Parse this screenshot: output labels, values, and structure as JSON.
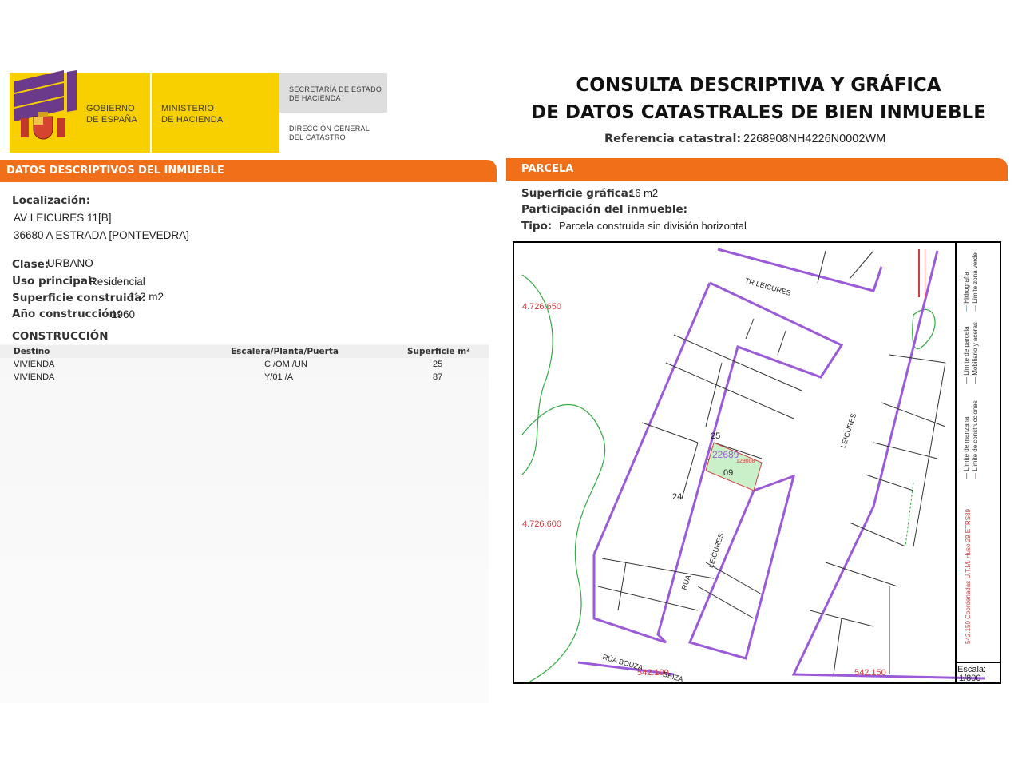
{
  "logo": {
    "gov_line1": "GOBIERNO",
    "gov_line2": "DE ESPAÑA",
    "min_line1": "MINISTERIO",
    "min_line2": "DE HACIENDA",
    "sec_line1": "SECRETARÍA DE ESTADO",
    "sec_line2": "DE HACIENDA",
    "dir_line1": "DIRECCIÓN GENERAL",
    "dir_line2": "DEL CATASTRO"
  },
  "header": {
    "title_line1": "CONSULTA DESCRIPTIVA Y GRÁFICA",
    "title_line2": "DE DATOS CATASTRALES DE BIEN INMUEBLE",
    "ref_label": "Referencia catastral:",
    "ref_value": "2268908NH4226N0002WM"
  },
  "left": {
    "section_title": "DATOS DESCRIPTIVOS DEL INMUEBLE",
    "loc_label": "Localización:",
    "loc_line1": "AV LEICURES 11[B]",
    "loc_line2": "36680 A ESTRADA [PONTEVEDRA]",
    "clase_label": "Clase:",
    "clase_value": "URBANO",
    "uso_label": "Uso principal:",
    "uso_value": "Residencial",
    "sup_label": "Superficie construida:",
    "sup_value": "112 m2",
    "ano_label": "Año construcción:",
    "ano_value": "1960",
    "construccion_title": "CONSTRUCCIÓN",
    "table": {
      "headers": [
        "Destino",
        "Escalera/Planta/Puerta",
        "Superficie m²"
      ],
      "rows": [
        [
          "VIVIENDA",
          "C /OM /UN",
          "25"
        ],
        [
          "VIVIENDA",
          "Y/01 /A",
          "87"
        ]
      ]
    }
  },
  "right": {
    "section_title": "PARCELA",
    "supg_label": "Superficie gráfica:",
    "supg_value": "16 m2",
    "part_label": "Participación del inmueble:",
    "tipo_label": "Tipo:",
    "tipo_value": "Parcela construida sin división horizontal"
  },
  "map": {
    "coord_y1": "4.726.650",
    "coord_y2": "4.726.600",
    "coord_x1": "542.100",
    "coord_x2": "542.150",
    "street_top": "TR LEICURES",
    "street_main": "LEICURES",
    "street_rua1": "RÚA",
    "street_rua2": "LEICURES",
    "street_bottom": "RÚA BOUZA",
    "street_bottom2": "BEIZA",
    "parcel_id": "22689",
    "parcel_sub": "129008",
    "num_25": "25",
    "num_24": "24",
    "num_09": "09",
    "legend_1": "Límite de manzana",
    "legend_2": "Límite de parcela",
    "legend_3": "Hidrografía",
    "legend_4": "Límite de construcciones",
    "legend_5": "Mobiliario y aceras",
    "legend_6": "Límite zona verde",
    "legend_coord": "542.150 Coordenadas U.T.M. Huso 29 ETRS89",
    "scale_label": "Escala:",
    "scale_value": "1/800",
    "colors": {
      "parcel": "#9b5bd8",
      "green": "#33aa44",
      "coord": "#d04040"
    }
  }
}
